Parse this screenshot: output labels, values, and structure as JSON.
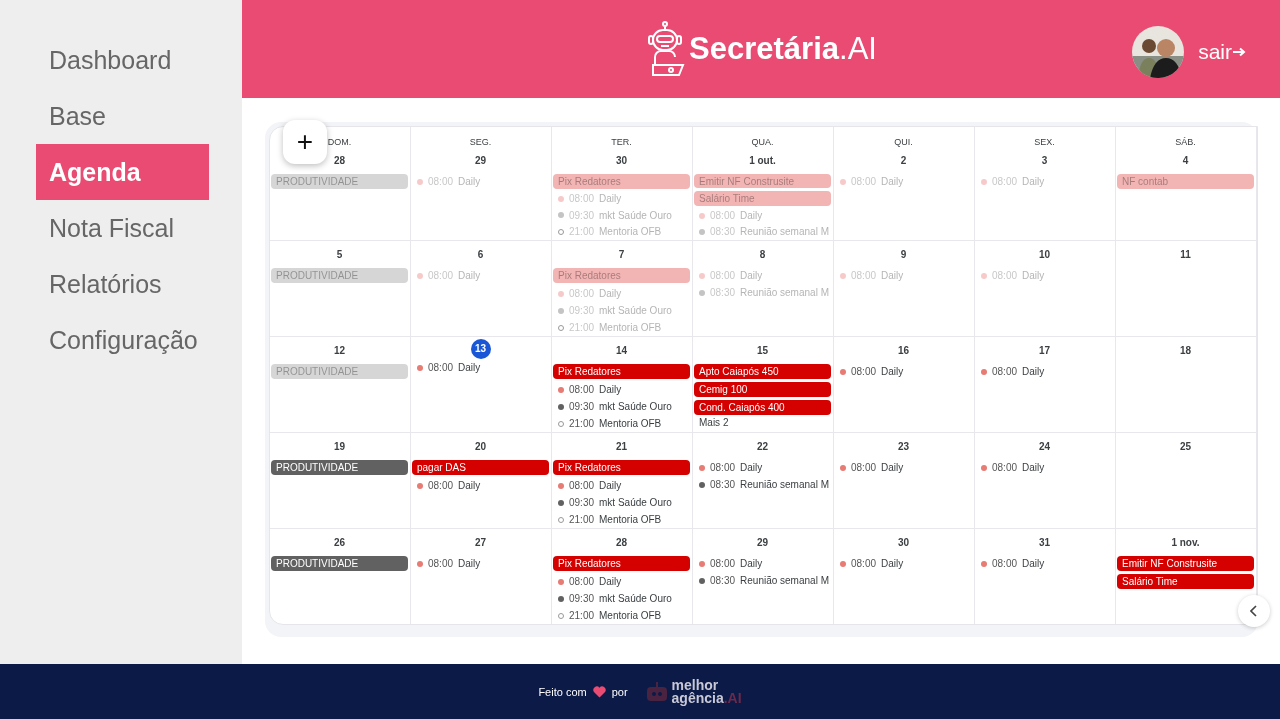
{
  "sidebar": {
    "items": [
      {
        "label": "Dashboard",
        "selected": false
      },
      {
        "label": "Base",
        "selected": false
      },
      {
        "label": "Agenda",
        "selected": true
      },
      {
        "label": "Nota Fiscal",
        "selected": false
      },
      {
        "label": "Relatórios",
        "selected": false
      },
      {
        "label": "Configuração",
        "selected": false
      }
    ]
  },
  "header": {
    "brand": "Secretária",
    "brand_suffix": ".AI",
    "logout": "sair"
  },
  "calendar": {
    "add_button": "+",
    "weekdays": [
      "DOM.",
      "SEG.",
      "TER.",
      "QUA.",
      "QUI.",
      "SEX.",
      "SÁB."
    ],
    "weeks": [
      {
        "days": [
          {
            "label": "28",
            "past": true,
            "today": false,
            "events": [
              {
                "kind": "bar",
                "title": "PRODUTIVIDADE",
                "color": "#d6d6d6"
              }
            ]
          },
          {
            "label": "29",
            "past": true,
            "today": false,
            "events": [
              {
                "kind": "timed",
                "time": "08:00",
                "title": "Daily",
                "color": "#f7caca"
              }
            ]
          },
          {
            "label": "30",
            "past": true,
            "today": false,
            "events": [
              {
                "kind": "bar",
                "title": "Pix Redatores",
                "color": "#f3b4b4"
              },
              {
                "kind": "timed",
                "time": "08:00",
                "title": "Daily",
                "color": "#f7caca"
              },
              {
                "kind": "timed",
                "time": "09:30",
                "title": "mkt Saúde Ouro",
                "color": "#c4c4c4"
              },
              {
                "kind": "timed",
                "time": "21:00",
                "title": "Mentoria OFB",
                "outline": true
              }
            ]
          },
          {
            "label": "1 out.",
            "past": true,
            "today": false,
            "events": [
              {
                "kind": "bar",
                "title": "Emitir NF Construsite",
                "color": "#f3b4b4"
              },
              {
                "kind": "bar",
                "title": "Salário Time",
                "color": "#f3b4b4"
              },
              {
                "kind": "timed",
                "time": "08:00",
                "title": "Daily",
                "color": "#f7caca"
              },
              {
                "kind": "timed",
                "time": "08:30",
                "title": "Reunião semanal M",
                "color": "#c4c4c4"
              }
            ]
          },
          {
            "label": "2",
            "past": true,
            "today": false,
            "events": [
              {
                "kind": "timed",
                "time": "08:00",
                "title": "Daily",
                "color": "#f7caca"
              }
            ]
          },
          {
            "label": "3",
            "past": true,
            "today": false,
            "events": [
              {
                "kind": "timed",
                "time": "08:00",
                "title": "Daily",
                "color": "#f7caca"
              }
            ]
          },
          {
            "label": "4",
            "past": true,
            "today": false,
            "events": [
              {
                "kind": "bar",
                "title": "NF contab",
                "color": "#f3b4b4"
              }
            ]
          }
        ]
      },
      {
        "days": [
          {
            "label": "5",
            "past": true,
            "today": false,
            "events": [
              {
                "kind": "bar",
                "title": "PRODUTIVIDADE",
                "color": "#d6d6d6"
              }
            ]
          },
          {
            "label": "6",
            "past": true,
            "today": false,
            "events": [
              {
                "kind": "timed",
                "time": "08:00",
                "title": "Daily",
                "color": "#f7caca"
              }
            ]
          },
          {
            "label": "7",
            "past": true,
            "today": false,
            "events": [
              {
                "kind": "bar",
                "title": "Pix Redatores",
                "color": "#f3b4b4"
              },
              {
                "kind": "timed",
                "time": "08:00",
                "title": "Daily",
                "color": "#f7caca"
              },
              {
                "kind": "timed",
                "time": "09:30",
                "title": "mkt Saúde Ouro",
                "color": "#c4c4c4"
              },
              {
                "kind": "timed",
                "time": "21:00",
                "title": "Mentoria OFB",
                "outline": true
              }
            ]
          },
          {
            "label": "8",
            "past": true,
            "today": false,
            "events": [
              {
                "kind": "timed",
                "time": "08:00",
                "title": "Daily",
                "color": "#f7caca"
              },
              {
                "kind": "timed",
                "time": "08:30",
                "title": "Reunião semanal M",
                "color": "#c4c4c4"
              }
            ]
          },
          {
            "label": "9",
            "past": true,
            "today": false,
            "events": [
              {
                "kind": "timed",
                "time": "08:00",
                "title": "Daily",
                "color": "#f7caca"
              }
            ]
          },
          {
            "label": "10",
            "past": true,
            "today": false,
            "events": [
              {
                "kind": "timed",
                "time": "08:00",
                "title": "Daily",
                "color": "#f7caca"
              }
            ]
          },
          {
            "label": "11",
            "today": false
          }
        ]
      },
      {
        "days": [
          {
            "label": "12",
            "past": true,
            "today": false,
            "events": [
              {
                "kind": "bar",
                "title": "PRODUTIVIDADE",
                "color": "#d6d6d6"
              }
            ]
          },
          {
            "label": "13",
            "past": false,
            "today": true,
            "events": [
              {
                "kind": "timed",
                "time": "08:00",
                "title": "Daily",
                "color": "#e67c73"
              }
            ]
          },
          {
            "label": "14",
            "past": false,
            "today": false,
            "events": [
              {
                "kind": "bar",
                "title": "Pix Redatores",
                "color": "#d50000"
              },
              {
                "kind": "timed",
                "time": "08:00",
                "title": "Daily",
                "color": "#e67c73"
              },
              {
                "kind": "timed",
                "time": "09:30",
                "title": "mkt Saúde Ouro",
                "color": "#616161"
              },
              {
                "kind": "timed",
                "time": "21:00",
                "title": "Mentoria OFB",
                "outline": true
              }
            ]
          },
          {
            "label": "15",
            "past": false,
            "today": false,
            "events": [
              {
                "kind": "bar",
                "title": "Apto Caiapós 450",
                "color": "#d50000"
              },
              {
                "kind": "bar",
                "title": "Cemig 100",
                "color": "#d50000"
              },
              {
                "kind": "bar",
                "title": "Cond. Caiapós 400",
                "color": "#d50000"
              },
              {
                "kind": "more",
                "title": "Mais 2"
              }
            ]
          },
          {
            "label": "16",
            "past": false,
            "today": false,
            "events": [
              {
                "kind": "timed",
                "time": "08:00",
                "title": "Daily",
                "color": "#e67c73"
              }
            ]
          },
          {
            "label": "17",
            "past": false,
            "today": false,
            "events": [
              {
                "kind": "timed",
                "time": "08:00",
                "title": "Daily",
                "color": "#e67c73"
              }
            ]
          },
          {
            "label": "18",
            "today": false
          }
        ]
      },
      {
        "days": [
          {
            "label": "19",
            "past": false,
            "today": false,
            "events": [
              {
                "kind": "bar",
                "title": "PRODUTIVIDADE",
                "color": "#616161"
              }
            ]
          },
          {
            "label": "20",
            "past": false,
            "today": false,
            "events": [
              {
                "kind": "bar",
                "title": "pagar DAS",
                "color": "#d50000"
              },
              {
                "kind": "timed",
                "time": "08:00",
                "title": "Daily",
                "color": "#e67c73"
              }
            ]
          },
          {
            "label": "21",
            "past": false,
            "today": false,
            "events": [
              {
                "kind": "bar",
                "title": "Pix Redatores",
                "color": "#d50000"
              },
              {
                "kind": "timed",
                "time": "08:00",
                "title": "Daily",
                "color": "#e67c73"
              },
              {
                "kind": "timed",
                "time": "09:30",
                "title": "mkt Saúde Ouro",
                "color": "#616161"
              },
              {
                "kind": "timed",
                "time": "21:00",
                "title": "Mentoria OFB",
                "outline": true
              }
            ]
          },
          {
            "label": "22",
            "past": false,
            "today": false,
            "events": [
              {
                "kind": "timed",
                "time": "08:00",
                "title": "Daily",
                "color": "#e67c73"
              },
              {
                "kind": "timed",
                "time": "08:30",
                "title": "Reunião semanal M",
                "color": "#616161"
              }
            ]
          },
          {
            "label": "23",
            "past": false,
            "today": false,
            "events": [
              {
                "kind": "timed",
                "time": "08:00",
                "title": "Daily",
                "color": "#e67c73"
              }
            ]
          },
          {
            "label": "24",
            "past": false,
            "today": false,
            "events": [
              {
                "kind": "timed",
                "time": "08:00",
                "title": "Daily",
                "color": "#e67c73"
              }
            ]
          },
          {
            "label": "25",
            "today": false
          }
        ]
      },
      {
        "days": [
          {
            "label": "26",
            "past": false,
            "today": false,
            "events": [
              {
                "kind": "bar",
                "title": "PRODUTIVIDADE",
                "color": "#616161"
              }
            ]
          },
          {
            "label": "27",
            "past": false,
            "today": false,
            "events": [
              {
                "kind": "timed",
                "time": "08:00",
                "title": "Daily",
                "color": "#e67c73"
              }
            ]
          },
          {
            "label": "28",
            "past": false,
            "today": false,
            "events": [
              {
                "kind": "bar",
                "title": "Pix Redatores",
                "color": "#d50000"
              },
              {
                "kind": "timed",
                "time": "08:00",
                "title": "Daily",
                "color": "#e67c73"
              },
              {
                "kind": "timed",
                "time": "09:30",
                "title": "mkt Saúde Ouro",
                "color": "#616161"
              },
              {
                "kind": "timed",
                "time": "21:00",
                "title": "Mentoria OFB",
                "outline": true
              }
            ]
          },
          {
            "label": "29",
            "past": false,
            "today": false,
            "events": [
              {
                "kind": "timed",
                "time": "08:00",
                "title": "Daily",
                "color": "#e67c73"
              },
              {
                "kind": "timed",
                "time": "08:30",
                "title": "Reunião semanal M",
                "color": "#616161"
              }
            ]
          },
          {
            "label": "30",
            "past": false,
            "today": false,
            "events": [
              {
                "kind": "timed",
                "time": "08:00",
                "title": "Daily",
                "color": "#e67c73"
              }
            ]
          },
          {
            "label": "31",
            "past": false,
            "today": false,
            "events": [
              {
                "kind": "timed",
                "time": "08:00",
                "title": "Daily",
                "color": "#e67c73"
              }
            ]
          },
          {
            "label": "1 nov.",
            "past": false,
            "today": false,
            "events": [
              {
                "kind": "bar",
                "title": "Emitir NF Construsite",
                "color": "#d50000"
              },
              {
                "kind": "bar",
                "title": "Salário Time",
                "color": "#d50000"
              }
            ]
          }
        ]
      }
    ]
  },
  "footer": {
    "made_with": "Feito com",
    "by": "por",
    "logo_line1": "melhor",
    "logo_line2": "agência",
    "logo_suffix": ".AI"
  }
}
